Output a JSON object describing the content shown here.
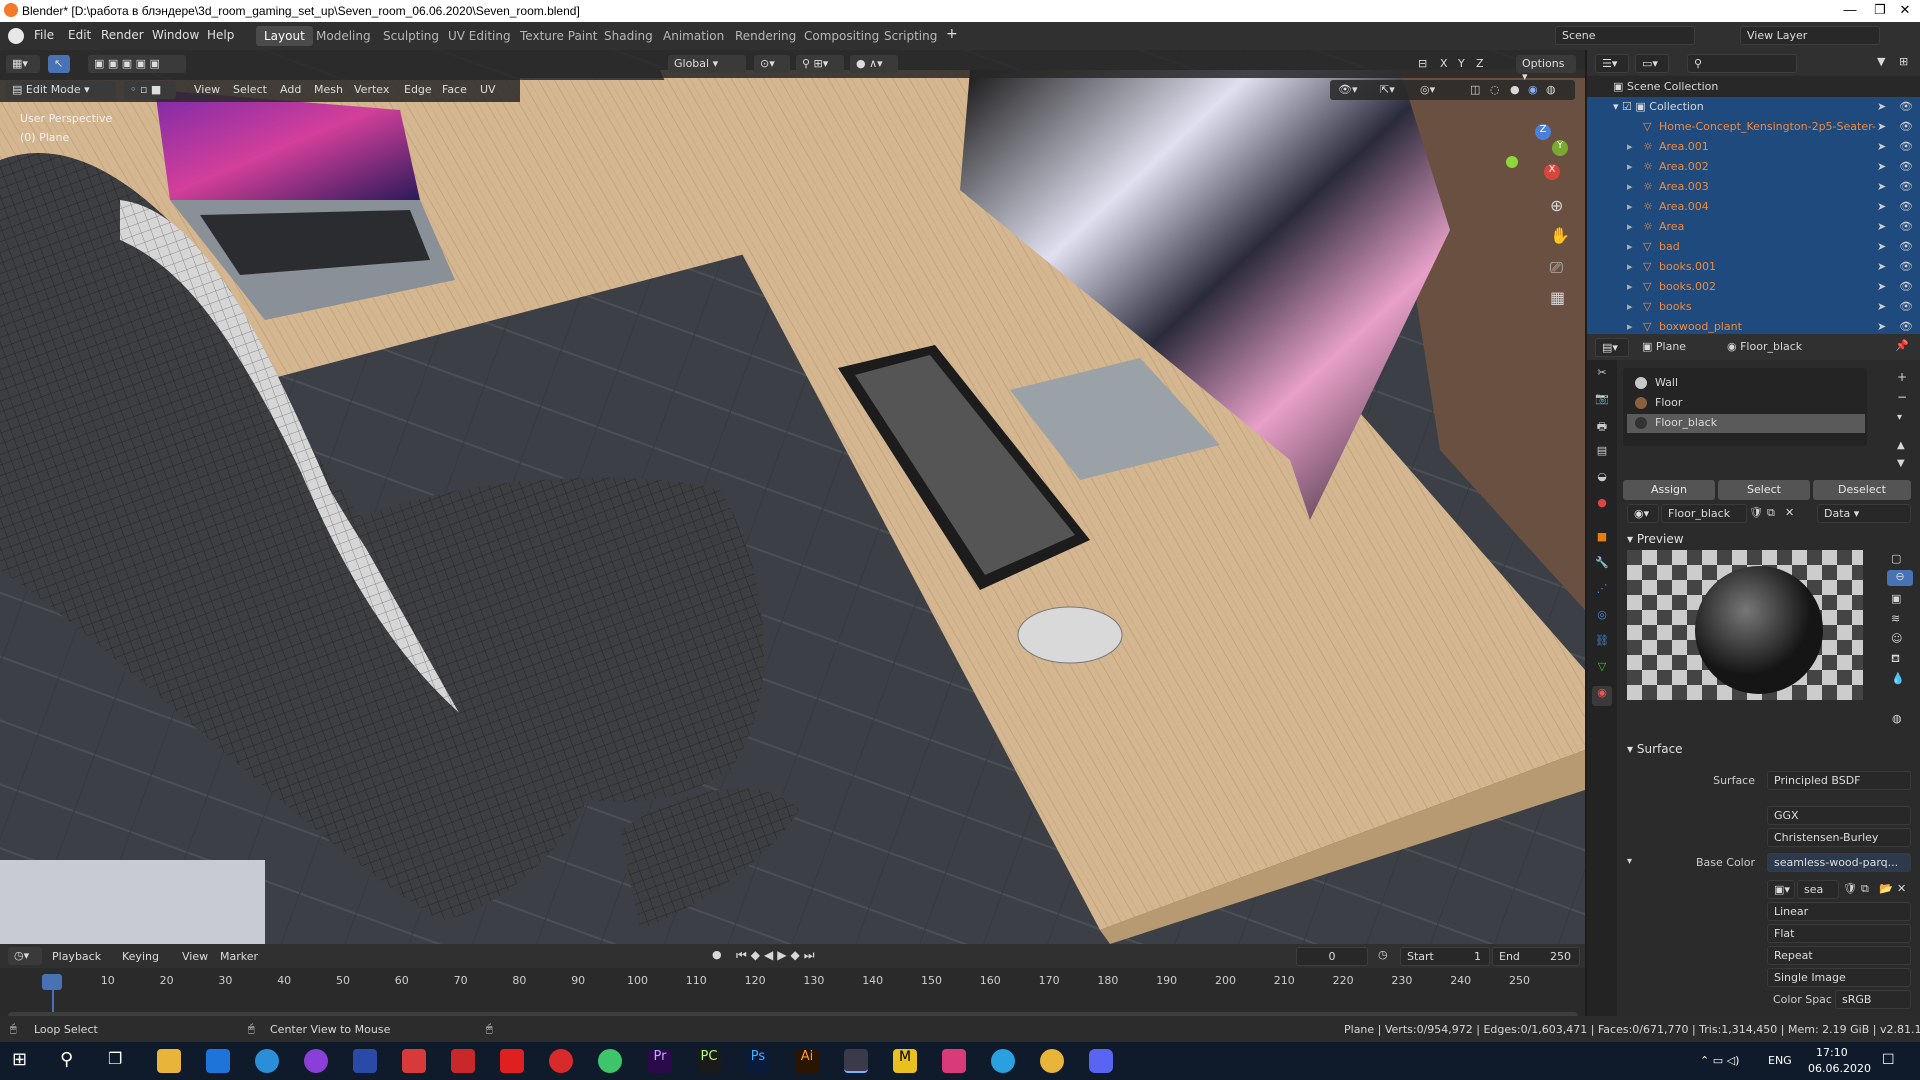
{
  "window": {
    "title": "Blender* [D:\\работа в блэндере\\3d_room_gaming_set_up\\Seven_room_06.06.2020\\Seven_room.blend]",
    "minimize": "—",
    "maximize": "❐",
    "close": "✕"
  },
  "menubar": {
    "items": [
      "File",
      "Edit",
      "Render",
      "Window",
      "Help"
    ],
    "workspaces": [
      "Layout",
      "Modeling",
      "Sculpting",
      "UV Editing",
      "Texture Paint",
      "Shading",
      "Animation",
      "Rendering",
      "Compositing",
      "Scripting"
    ],
    "add_workspace": "+",
    "scene": "Scene",
    "view_layer": "View Layer"
  },
  "viewport": {
    "mode": "Edit Mode",
    "menus": [
      "View",
      "Select",
      "Add",
      "Mesh",
      "Vertex",
      "Edge",
      "Face",
      "UV"
    ],
    "transform_orientation": "Global",
    "options": "Options",
    "axes": [
      "X",
      "Y",
      "Z"
    ],
    "perspective": "User Perspective",
    "object": "(0) Plane",
    "gizmo": {
      "x": "X",
      "y": "Y",
      "z": "Z"
    }
  },
  "outliner": {
    "scene_collection": "Scene Collection",
    "collection": "Collection",
    "items": [
      "Home-Concept_Kensington-2p5-Seater-",
      "Area.001",
      "Area.002",
      "Area.003",
      "Area.004",
      "Area",
      "bad",
      "books.001",
      "books.002",
      "books",
      "boxwood_plant"
    ]
  },
  "properties": {
    "object": "Plane",
    "material": "Floor_black",
    "slots": [
      "Wall",
      "Floor",
      "Floor_black"
    ],
    "assign": "Assign",
    "select": "Select",
    "deselect": "Deselect",
    "material_field": "Floor_black",
    "link": "Data",
    "preview_label": "Preview",
    "surface_section": "Surface",
    "surface_label": "Surface",
    "surface_value": "Principled BSDF",
    "distribution": "GGX",
    "subsurface": "Christensen-Burley",
    "base_color_label": "Base Color",
    "base_color_value": "seamless-wood-parq...",
    "image_name": "sea",
    "interpolation": "Linear",
    "projection": "Flat",
    "extension": "Repeat",
    "source": "Single Image",
    "color_space_label": "Color Spac",
    "color_space_value": "sRGB"
  },
  "timeline": {
    "menus": [
      "Playback",
      "Keying",
      "View",
      "Marker"
    ],
    "current_frame": "0",
    "start_label": "Start",
    "start": "1",
    "end_label": "End",
    "end": "250",
    "ticks": [
      "0",
      "10",
      "20",
      "30",
      "40",
      "50",
      "60",
      "70",
      "80",
      "90",
      "100",
      "110",
      "120",
      "130",
      "140",
      "150",
      "160",
      "170",
      "180",
      "190",
      "200",
      "210",
      "220",
      "230",
      "240",
      "250"
    ]
  },
  "statusbar": {
    "left1": "Loop Select",
    "left2": "Center View to Mouse",
    "stats": "Plane | Verts:0/954,972 | Edges:0/1,603,471 | Faces:0/671,770 | Tris:1,314,450 | Mem: 2.19 GiB | v2.81.16"
  },
  "taskbar": {
    "lang": "ENG",
    "time": "17:10",
    "date": "06.06.2020"
  },
  "colors": {
    "accent": "#4772b3",
    "selected_row": "#1e4a7e",
    "outliner_text": "#f08a3c",
    "wood": "#d8bc96"
  }
}
